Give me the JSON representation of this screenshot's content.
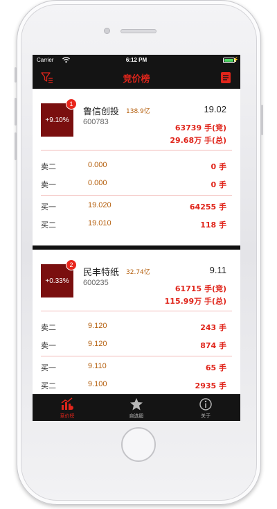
{
  "status_bar": {
    "carrier": "Carrier",
    "time": "6:12 PM"
  },
  "nav": {
    "title": "竞价榜",
    "left_icon": "filter-icon",
    "right_icon": "list-document-icon"
  },
  "colors": {
    "accent": "#e0251b",
    "change_box": "#7a0f0f",
    "price_text": "#b5600f",
    "bar": "#141414"
  },
  "stocks": [
    {
      "rank": "1",
      "change": "+9.10%",
      "name": "鲁信创投",
      "market_cap": "138.9亿",
      "code": "600783",
      "price": "19.02",
      "bid_volume": "63739 手(竞)",
      "total_volume": "29.68万 手(总)",
      "orders": [
        {
          "label": "卖二",
          "price": "0.000",
          "volume": "0 手"
        },
        {
          "label": "卖一",
          "price": "0.000",
          "volume": "0 手"
        },
        {
          "label": "买一",
          "price": "19.020",
          "volume": "64255 手"
        },
        {
          "label": "买二",
          "price": "19.010",
          "volume": "118 手"
        }
      ]
    },
    {
      "rank": "2",
      "change": "+0.33%",
      "name": "民丰特纸",
      "market_cap": "32.74亿",
      "code": "600235",
      "price": "9.11",
      "bid_volume": "61715 手(竞)",
      "total_volume": "115.99万 手(总)",
      "orders": [
        {
          "label": "卖二",
          "price": "9.120",
          "volume": "243 手"
        },
        {
          "label": "卖一",
          "price": "9.120",
          "volume": "874 手"
        },
        {
          "label": "买一",
          "price": "9.110",
          "volume": "65 手"
        },
        {
          "label": "买二",
          "price": "9.100",
          "volume": "2935 手"
        }
      ]
    }
  ],
  "tabs": [
    {
      "label": "竞价榜",
      "icon": "bar-chart-icon",
      "active": true
    },
    {
      "label": "自选股",
      "icon": "star-icon",
      "active": false
    },
    {
      "label": "关于",
      "icon": "info-icon",
      "active": false
    }
  ]
}
